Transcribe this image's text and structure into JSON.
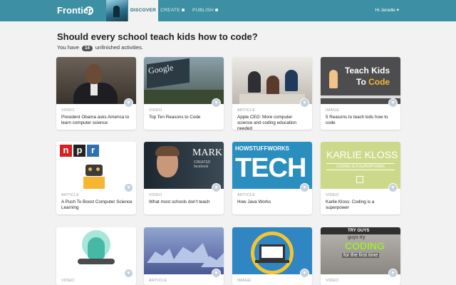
{
  "header": {
    "brand": "Frontier",
    "tabs": [
      {
        "label": "DISCOVER",
        "active": true
      },
      {
        "label": "CREATE",
        "locked": true
      },
      {
        "label": "PUBLISH",
        "locked": true
      }
    ],
    "user_label": "Hi Jenelle",
    "user_chevron": "▾"
  },
  "page": {
    "title": "Should every school teach kids how to code?",
    "subline_prefix": "You have",
    "unfinished_count": "14",
    "subline_suffix": "unfinished activities."
  },
  "cards": [
    {
      "type": "VIDEO",
      "title": "President Obama asks America to learn computer science"
    },
    {
      "type": "VIDEO",
      "title": "Top Ten Reasons to Code"
    },
    {
      "type": "ARTICLE",
      "title": "Apple CEO: More computer science and coding education needed"
    },
    {
      "type": "IMAGE",
      "title": "5 Reasons to teach kids how to code"
    },
    {
      "type": "ARTICLE",
      "title": "A Push To Boost Computer Science Learning"
    },
    {
      "type": "VIDEO",
      "title": "What most schools don't teach"
    },
    {
      "type": "ARTICLE",
      "title": "How Java Works"
    },
    {
      "type": "VIDEO",
      "title": "Karlie Kloss: Coding is a superpower"
    },
    {
      "type": "VIDEO",
      "title": ""
    },
    {
      "type": "ARTICLE",
      "title": ""
    },
    {
      "type": "IMAGE",
      "title": ""
    },
    {
      "type": "VIDEO",
      "title": ""
    }
  ],
  "image_text": {
    "google": "Google",
    "teach_line1": "Teach Kids",
    "teach_line2_a": "To ",
    "teach_line2_b": "Code",
    "npr_n": "n",
    "npr_p": "p",
    "npr_r": "r",
    "mark": "MARK",
    "mark_sub": "CREATED facebook",
    "hsw": "HOWSTUFFWORKS",
    "tech": "TECH",
    "karlie_name": "KARLIE KLOSS",
    "karlie_tag": "CODING IS A SUPERPOWER",
    "tryguys_1": "TRY GUYS",
    "tryguys_2": "guys try",
    "tryguys_3": "CODING",
    "tryguys_4": "for the first time"
  },
  "icons": {
    "heart": "♥",
    "lock": "lock-icon"
  },
  "colors": {
    "header": "#3d8fa3",
    "background": "#f2f2f2",
    "heart_button": "#c6d2dc"
  }
}
